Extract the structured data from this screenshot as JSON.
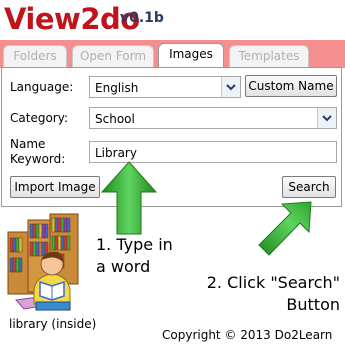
{
  "app": {
    "title": "View2do",
    "version": "v0.1b"
  },
  "tabs": [
    {
      "label": "Folders",
      "active": false
    },
    {
      "label": "Open Form",
      "active": false
    },
    {
      "label": "Images",
      "active": true
    },
    {
      "label": "Templates",
      "active": false
    }
  ],
  "form": {
    "language_label": "Language:",
    "language_value": "English",
    "custom_name_button": "Custom Name",
    "category_label": "Category:",
    "category_value": "School",
    "keyword_label": "Name Keyword:",
    "keyword_value": "Library",
    "import_button": "Import Image",
    "search_button": "Search"
  },
  "result": {
    "caption": "library (inside)"
  },
  "annotations": {
    "step1": "1. Type in a word",
    "step2": "2. Click \"Search\" Button"
  },
  "footer": {
    "copyright": "Copyright © 2013 Do2Learn"
  },
  "colors": {
    "title_red": "#c0141c",
    "version_navy": "#2a3a66",
    "tabbar_pink": "#f58f8f",
    "arrow_green": "#2fa52f"
  }
}
